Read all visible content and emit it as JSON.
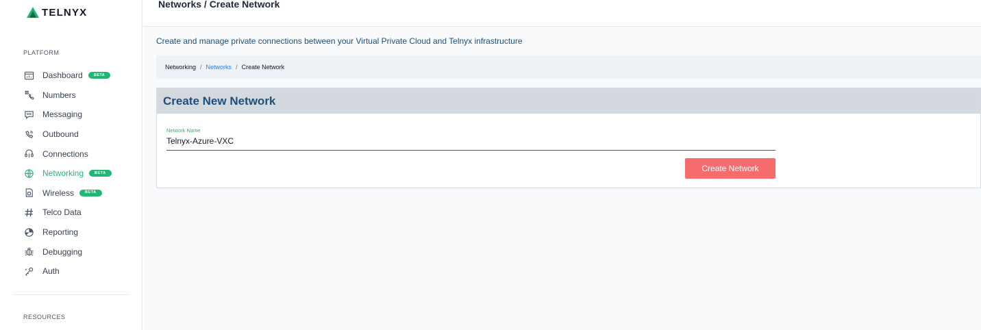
{
  "brand": {
    "name": "TELNYX",
    "accent": "#22b573"
  },
  "header": {
    "title": "Networks / Create Network"
  },
  "sidebar": {
    "platform_label": "PLATFORM",
    "resources_label": "RESOURCES",
    "items": [
      {
        "label": "Dashboard",
        "icon": "dashboard-icon",
        "badge": "BETA",
        "active": false
      },
      {
        "label": "Numbers",
        "icon": "numbers-icon",
        "active": false
      },
      {
        "label": "Messaging",
        "icon": "messaging-icon",
        "active": false
      },
      {
        "label": "Outbound",
        "icon": "phone-icon",
        "active": false
      },
      {
        "label": "Connections",
        "icon": "connections-icon",
        "active": false
      },
      {
        "label": "Networking",
        "icon": "networking-icon",
        "badge": "BETA",
        "active": true
      },
      {
        "label": "Wireless",
        "icon": "sim-card-icon",
        "badge": "BETA",
        "active": false
      },
      {
        "label": "Telco Data",
        "icon": "hash-icon",
        "active": false
      },
      {
        "label": "Reporting",
        "icon": "pie-chart-icon",
        "active": false
      },
      {
        "label": "Debugging",
        "icon": "bug-icon",
        "active": false
      },
      {
        "label": "Auth",
        "icon": "key-icon",
        "active": false
      }
    ]
  },
  "main": {
    "description": "Create and manage private connections between your Virtual Private Cloud and Telnyx infrastructure",
    "breadcrumb": [
      "Networking",
      "Networks",
      "Create Network"
    ],
    "card": {
      "title": "Create New Network",
      "field_label": "Network Name",
      "field_value": "Telnyx-Azure-VXC",
      "button_label": "Create Network"
    }
  }
}
